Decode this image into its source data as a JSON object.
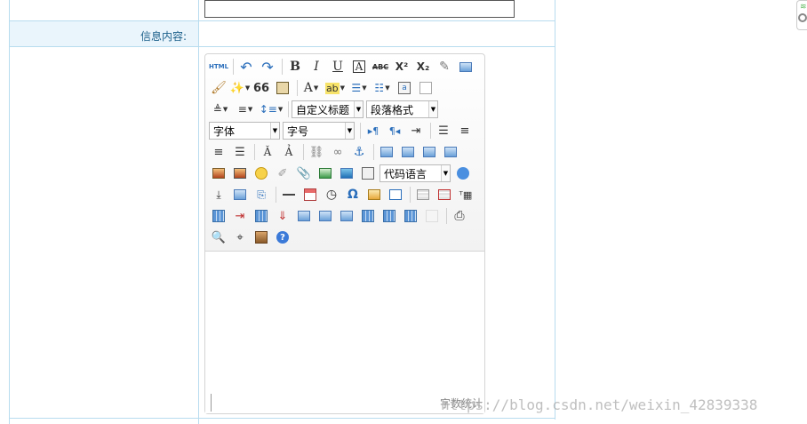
{
  "form": {
    "content_label": "信息内容:"
  },
  "editor": {
    "toolbar": {
      "row1": [
        "html-icon",
        "undo-icon",
        "redo-icon",
        "bold-icon",
        "italic-icon",
        "underline-icon",
        "font-border-icon",
        "strikethrough-icon",
        "superscript-icon",
        "subscript-icon",
        "eraser-icon",
        "preview-icon"
      ],
      "row2": [
        "format-painter-icon",
        "auto-format-icon",
        "blockquote-icon",
        "paste-text-icon",
        "font-color-icon",
        "background-color-icon",
        "ordered-list-icon",
        "unordered-list-icon",
        "select-all-icon",
        "clear-doc-icon"
      ],
      "row3": [
        "row-spacing-top-icon",
        "row-spacing-bottom-icon",
        "line-height-icon"
      ],
      "custom_title": "自定义标题",
      "paragraph_format": "段落格式",
      "font_family": "字体",
      "font_size": "字号",
      "code_language": "代码语言",
      "text_glyphs": {
        "html": "HTML",
        "bold": "B",
        "italic": "I",
        "underline": "U",
        "font_border": "A",
        "strike": "ABC",
        "superscript": "X²",
        "subscript": "X₂",
        "blockquote": "66",
        "font_color": "A",
        "bg_color": "ab",
        "omega": "Ω",
        "help": "?"
      }
    },
    "word_count_label": "字数统计"
  },
  "watermark": "https://blog.csdn.net/weixin_42839338",
  "colors": {
    "grid_line": "#b8dcef",
    "label_bg": "#eaf5fc",
    "label_text": "#1a5f8a",
    "accent_blue": "#2a6ebb"
  }
}
